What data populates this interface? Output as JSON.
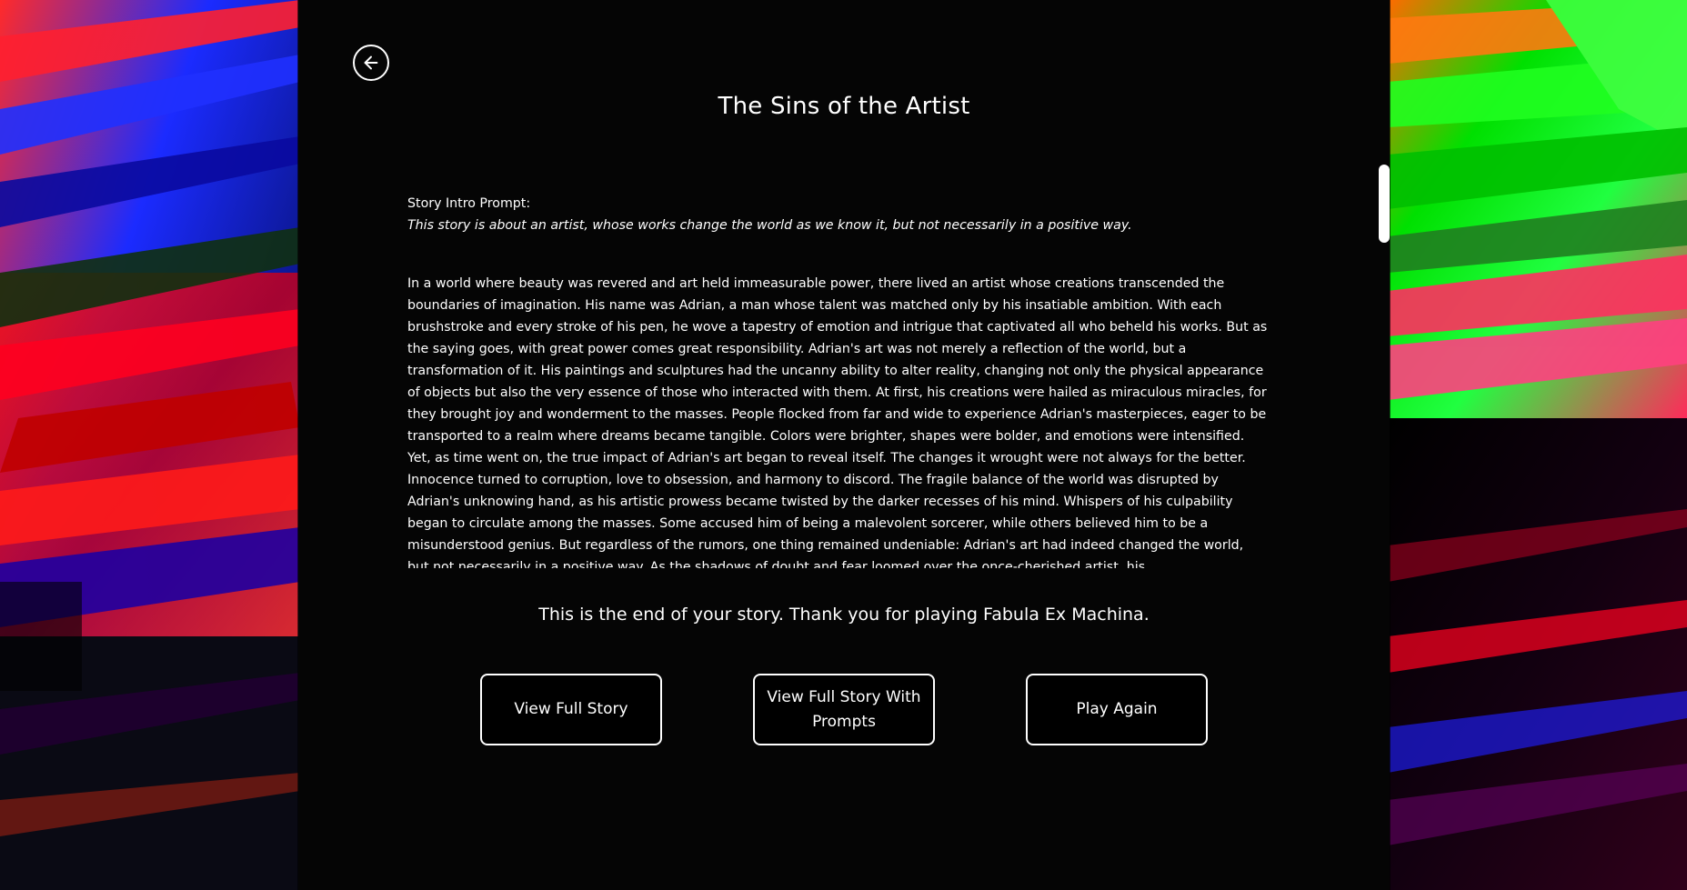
{
  "page": {
    "title": "The Sins of the Artist",
    "back_icon": "arrow-left-icon"
  },
  "story": {
    "prompt_label": "Story Intro Prompt:",
    "prompt_text": "This story is about an artist, whose works change the world as we know it, but not necessarily in a positive way.",
    "body": "In a world where beauty was revered and art held immeasurable power, there lived an artist whose creations transcended the boundaries of imagination. His name was Adrian, a man whose talent was matched only by his insatiable ambition. With each brushstroke and every stroke of his pen, he wove a tapestry of emotion and intrigue that captivated all who beheld his works. But as the saying goes, with great power comes great responsibility. Adrian's art was not merely a reflection of the world, but a transformation of it. His paintings and sculptures had the uncanny ability to alter reality, changing not only the physical appearance of objects but also the very essence of those who interacted with them. At first, his creations were hailed as miraculous miracles, for they brought joy and wonderment to the masses. People flocked from far and wide to experience Adrian's masterpieces, eager to be transported to a realm where dreams became tangible. Colors were brighter, shapes were bolder, and emotions were intensified. Yet, as time went on, the true impact of Adrian's art began to reveal itself. The changes it wrought were not always for the better. Innocence turned to corruption, love to obsession, and harmony to discord. The fragile balance of the world was disrupted by Adrian's unknowing hand, as his artistic prowess became twisted by the darker recesses of his mind. Whispers of his culpability began to circulate among the masses. Some accused him of being a malevolent sorcerer, while others believed him to be a misunderstood genius. But regardless of the rumors, one thing remained undeniable: Adrian's art had indeed changed the world, but not necessarily in a positive way. As the shadows of doubt and fear loomed over the once-cherished artist, his"
  },
  "footer": {
    "end_message": "This is the end of your story. Thank you for playing Fabula Ex Machina."
  },
  "buttons": {
    "view_full_story": "View Full Story",
    "view_full_story_with_prompts": "View Full Story With Prompts",
    "play_again": "Play Again"
  },
  "colors": {
    "panel": "#050505",
    "text": "#ffffff",
    "accent_border": "#ffffff"
  }
}
